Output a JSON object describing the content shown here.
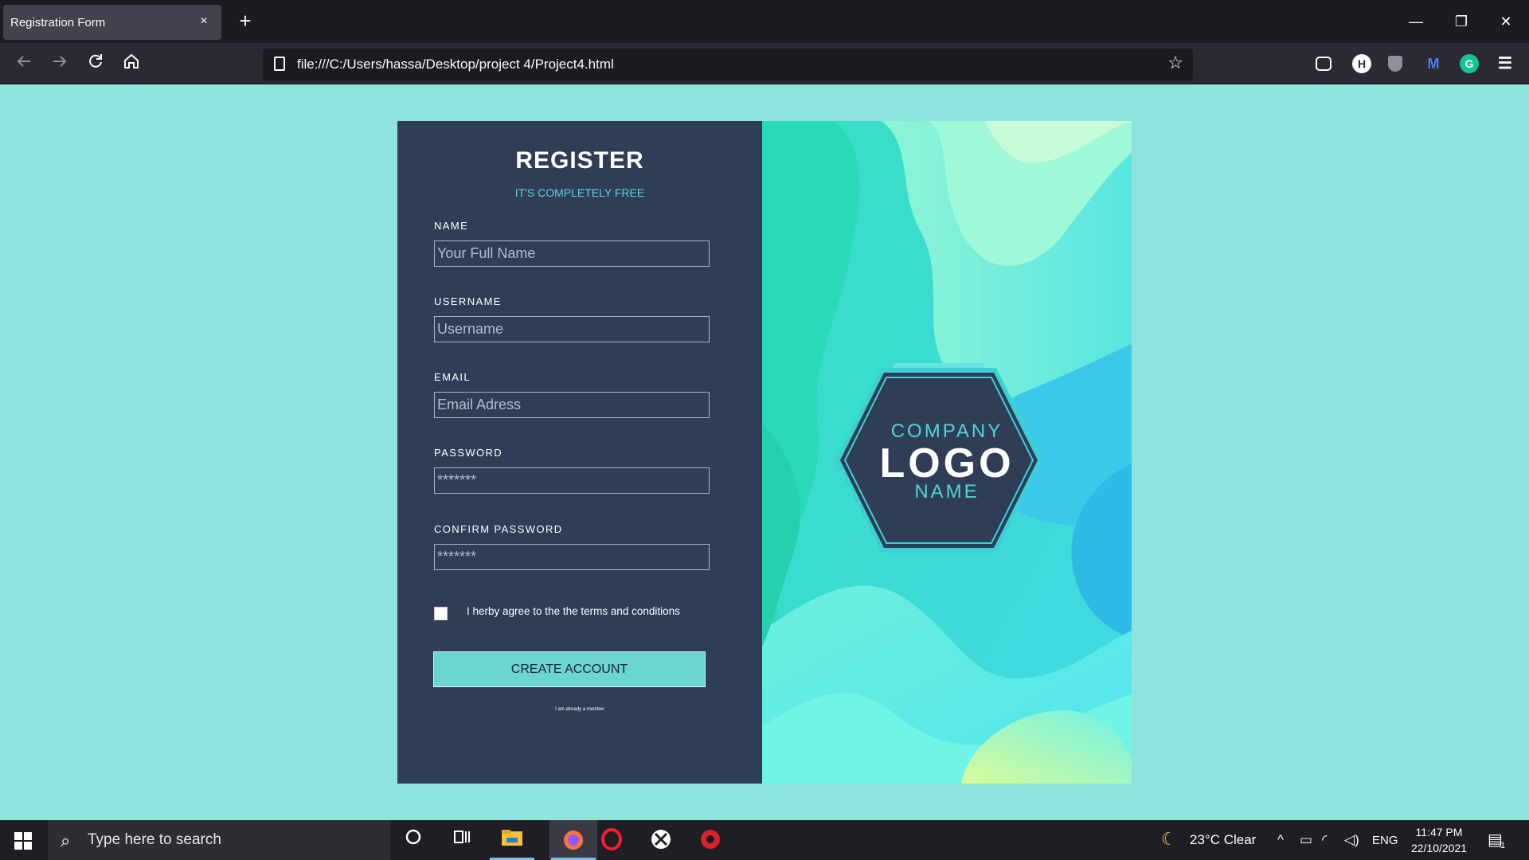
{
  "browser": {
    "tab_title": "Registration Form",
    "tab_close": "×",
    "new_tab": "+",
    "url": "file:///C:/Users/hassa/Desktop/project 4/Project4.html",
    "window_controls": {
      "minimize": "—",
      "restore": "❐",
      "close": "✕"
    },
    "nav_icons": [
      "back-arrow-icon",
      "forward-arrow-icon",
      "reload-icon",
      "home-icon"
    ],
    "extensions": [
      "pocket-icon",
      "h-extension-icon",
      "shield-extension-icon",
      "m-extension-icon",
      "grammarly-icon",
      "menu-icon"
    ]
  },
  "form": {
    "title": "REGISTER",
    "subtitle": "IT'S COMPLETELY FREE",
    "fields": [
      {
        "label": "NAME",
        "placeholder": "Your Full Name"
      },
      {
        "label": "USERNAME",
        "placeholder": "Username"
      },
      {
        "label": "EMAIL",
        "placeholder": "Email Adress"
      },
      {
        "label": "PASSWORD",
        "placeholder": "*******"
      },
      {
        "label": "CONFIRM PASSWORD",
        "placeholder": "*******"
      }
    ],
    "agree_text": "I herby agree to the the terms and conditions",
    "submit_label": "CREATE ACCOUNT",
    "member_link": "I am already a member"
  },
  "logo": {
    "line1": "COMPANY",
    "line2": "LOGO",
    "line3": "NAME"
  },
  "colors": {
    "page_bg": "#8ee3dc",
    "panel_bg": "#2f3d57",
    "accent": "#6bd5d0"
  },
  "taskbar": {
    "search_placeholder": "Type here to search",
    "weather": "23°C  Clear",
    "language": "ENG",
    "time": "11:47 PM",
    "date": "22/10/2021",
    "notification_count": "1"
  }
}
